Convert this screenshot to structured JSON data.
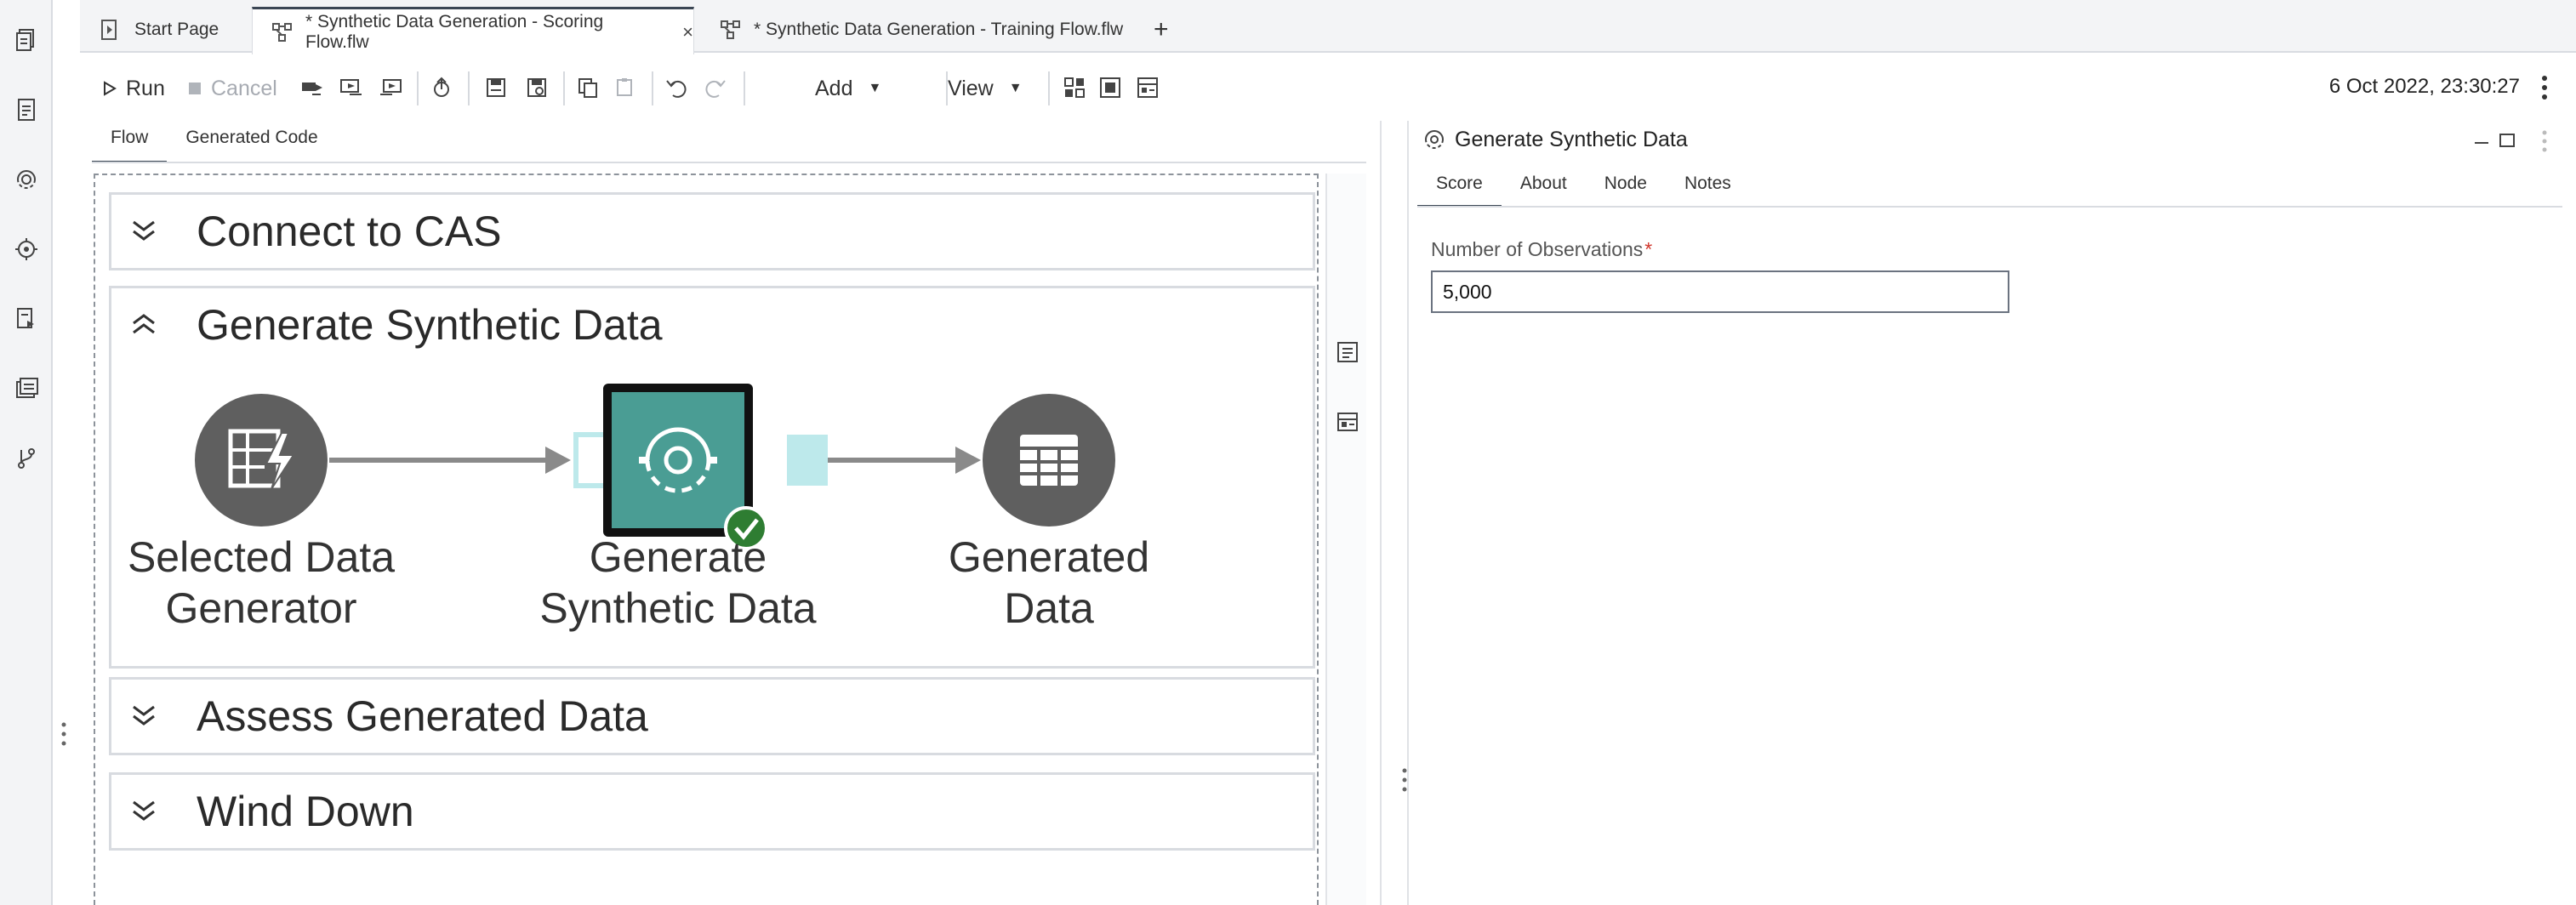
{
  "tabs": [
    {
      "label": "Start Page"
    },
    {
      "label": "* Synthetic Data Generation - Scoring Flow.flw",
      "close": "×"
    },
    {
      "label": "* Synthetic Data Generation - Training Flow.flw"
    }
  ],
  "new_tab_label": "+",
  "toolbar": {
    "run_label": "Run",
    "cancel_label": "Cancel",
    "add_label": "Add",
    "view_label": "View",
    "timestamp": "6 Oct 2022, 23:30:27"
  },
  "subtabs": [
    "Flow",
    "Generated Code"
  ],
  "sections": [
    {
      "title": "Connect to CAS"
    },
    {
      "title": "Generate Synthetic Data"
    },
    {
      "title": "Assess Generated Data"
    },
    {
      "title": "Wind Down"
    }
  ],
  "nodes": [
    {
      "label_line1": "Selected Data",
      "label_line2": "Generator"
    },
    {
      "label_line1": "Generate",
      "label_line2": "Synthetic Data"
    },
    {
      "label_line1": "Generated",
      "label_line2": "Data"
    }
  ],
  "properties": {
    "title": "Generate Synthetic Data",
    "tabs": [
      "Score",
      "About",
      "Node",
      "Notes"
    ],
    "field_label": "Number of Observations",
    "required_mark": "*",
    "field_value": "5,000"
  },
  "colors": {
    "accent_teal": "#4a9d94",
    "port_teal": "#bde9eb",
    "node_gray": "#5f5f5f",
    "success_green": "#2e7d32"
  }
}
